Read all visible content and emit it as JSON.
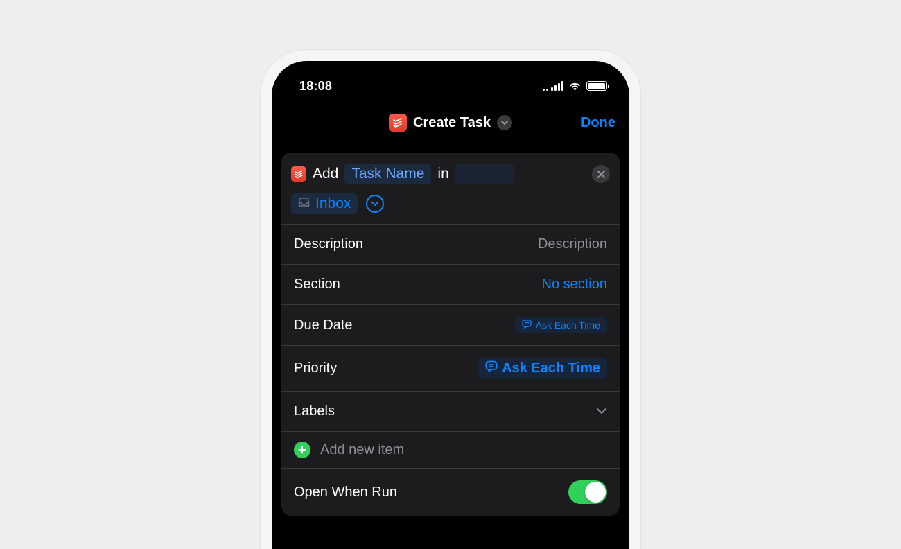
{
  "status": {
    "time": "18:08"
  },
  "nav": {
    "title": "Create Task",
    "done": "Done"
  },
  "action": {
    "add": "Add",
    "task_name_placeholder": "Task Name",
    "in": "in",
    "inbox": "Inbox"
  },
  "rows": {
    "description": {
      "label": "Description",
      "value": "Description"
    },
    "section": {
      "label": "Section",
      "value": "No section"
    },
    "due_date": {
      "label": "Due Date",
      "value": "Ask Each Time"
    },
    "priority": {
      "label": "Priority",
      "value": "Ask Each Time"
    },
    "labels": {
      "label": "Labels"
    },
    "add_item": "Add new item",
    "open_when_run": {
      "label": "Open When Run",
      "enabled": true
    }
  }
}
